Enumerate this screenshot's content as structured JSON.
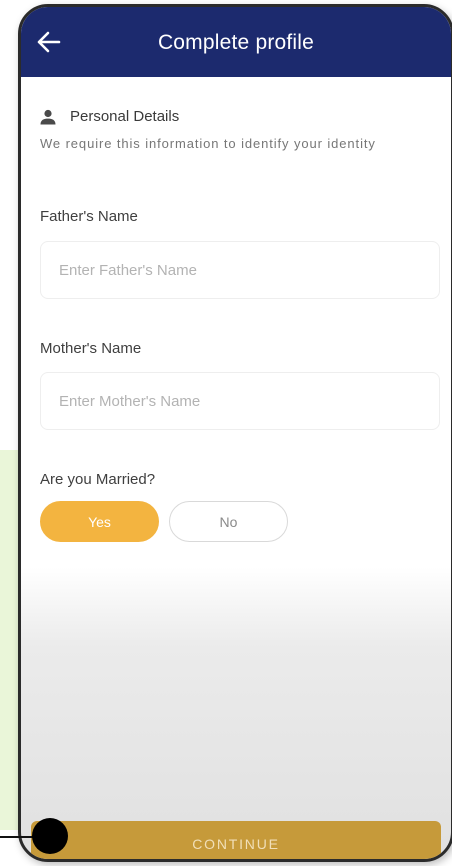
{
  "appbar": {
    "title": "Complete profile",
    "back_icon": "arrow-left-icon",
    "color": "#1c2a6e"
  },
  "section": {
    "icon": "person-icon",
    "title": "Personal Details",
    "subtitle": "We require this information to identify your identity"
  },
  "fields": {
    "father": {
      "label": "Father's Name",
      "placeholder": "Enter Father's Name",
      "value": ""
    },
    "mother": {
      "label": "Mother's Name",
      "placeholder": "Enter Mother's Name",
      "value": ""
    }
  },
  "marital": {
    "question": "Are you Married?",
    "options": [
      "Yes",
      "No"
    ],
    "selected": "Yes",
    "selected_color": "#f3b440"
  },
  "footer": {
    "continue_label": "CONTINUE",
    "button_color": "#c69a3a"
  }
}
